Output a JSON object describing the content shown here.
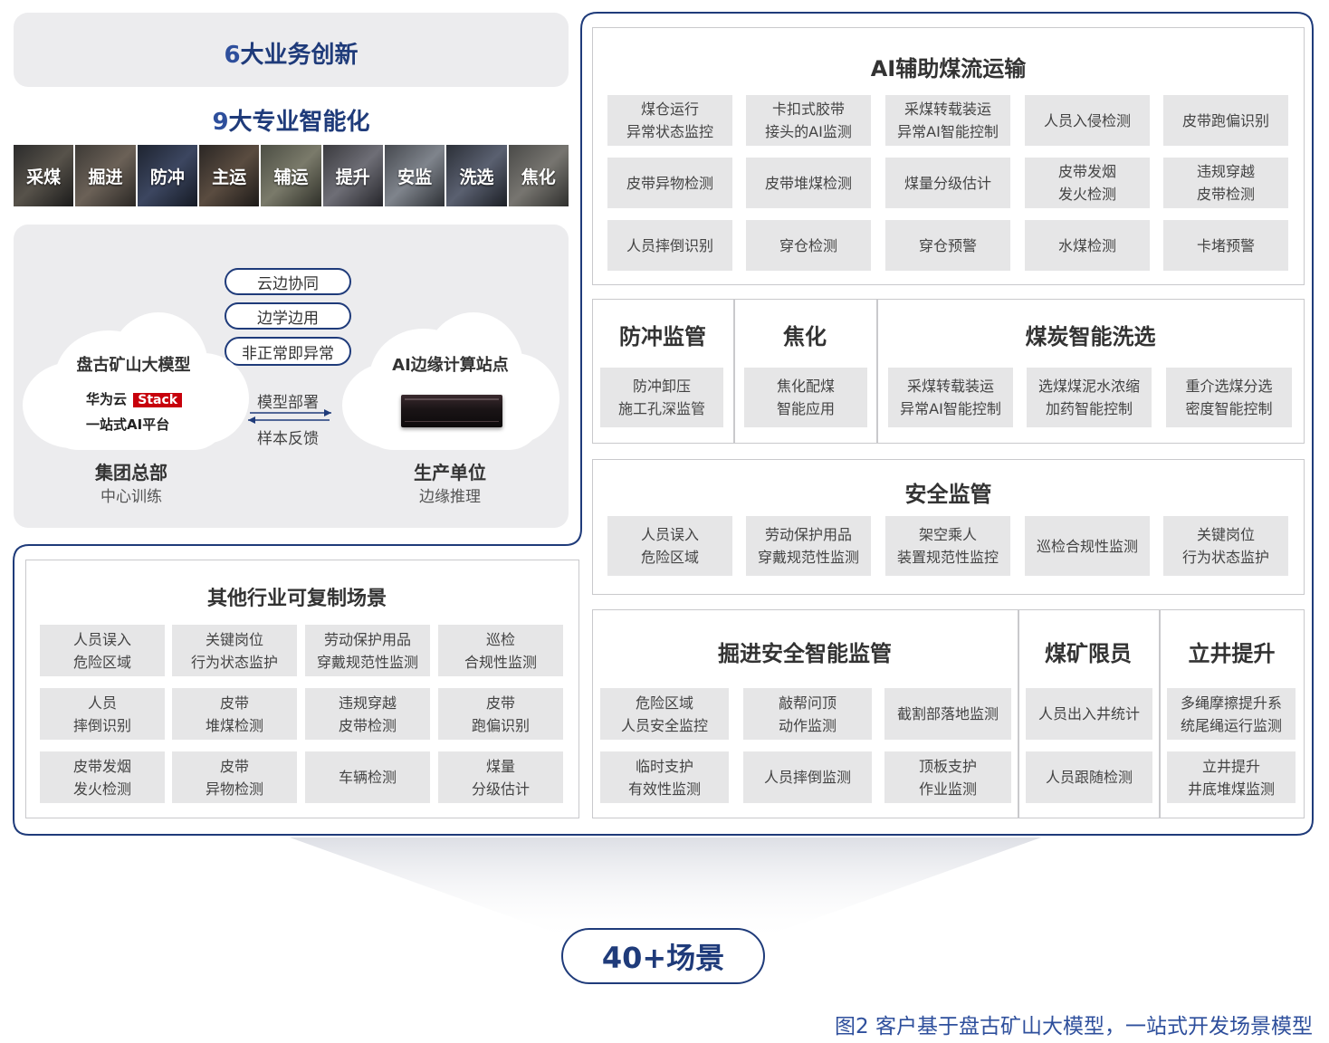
{
  "top_left": {
    "innovations_num": "6",
    "innovations_text": "大业务创新",
    "specializations_num": "9",
    "specializations_text": "大专业智能化",
    "strip": [
      "采煤",
      "掘进",
      "防冲",
      "主运",
      "辅运",
      "提升",
      "安监",
      "洗选",
      "焦化"
    ]
  },
  "architecture": {
    "pills": [
      "云边协同",
      "边学边用",
      "非正常即异常"
    ],
    "left_cloud_title": "盘古矿山大模型",
    "brand": "华为云",
    "brand_tag": "Stack",
    "platform": "一站式AI平台",
    "arrow_top": "模型部署",
    "arrow_bottom": "样本反馈",
    "right_cloud_title": "AI边缘计算站点",
    "left_label": "集团总部",
    "left_sub": "中心训练",
    "right_label": "生产单位",
    "right_sub": "边缘推理"
  },
  "other_industry": {
    "title": "其他行业可复制场景",
    "tiles": [
      "人员误入\n危险区域",
      "关键岗位\n行为状态监护",
      "劳动保护用品\n穿戴规范性监测",
      "巡检\n合规性监测",
      "人员\n摔倒识别",
      "皮带\n堆煤检测",
      "违规穿越\n皮带检测",
      "皮带\n跑偏识别",
      "皮带发烟\n发火检测",
      "皮带\n异物检测",
      "车辆检测",
      "煤量\n分级估计"
    ]
  },
  "ai_transport": {
    "title": "AI辅助煤流运输",
    "tiles": [
      "煤仓运行\n异常状态监控",
      "卡扣式胶带\n接头的AI监测",
      "采煤转载装运\n异常AI智能控制",
      "人员入侵检测",
      "皮带跑偏识别",
      "皮带异物检测",
      "皮带堆煤检测",
      "煤量分级估计",
      "皮带发烟\n发火检测",
      "违规穿越\n皮带检测",
      "人员摔倒识别",
      "穿仓检测",
      "穿仓预警",
      "水煤检测",
      "卡堵预警"
    ]
  },
  "row2": {
    "impact_title": "防冲监管",
    "impact_tile": "防冲卸压\n施工孔深监管",
    "coking_title": "焦化",
    "coking_tile": "焦化配煤\n智能应用",
    "washing_title": "煤炭智能洗选",
    "washing_tiles": [
      "采煤转载装运\n异常AI智能控制",
      "选煤煤泥水浓缩\n加药智能控制",
      "重介选煤分选\n密度智能控制"
    ]
  },
  "safety": {
    "title": "安全监管",
    "tiles": [
      "人员误入\n危险区域",
      "劳动保护用品\n穿戴规范性监测",
      "架空乘人\n装置规范性监控",
      "巡检合规性监测",
      "关键岗位\n行为状态监护"
    ]
  },
  "row4": {
    "tunnel_title": "掘进安全智能监管",
    "tunnel_tiles": [
      "危险区域\n人员安全监控",
      "敲帮问顶\n动作监测",
      "截割部落地监测",
      "临时支护\n有效性监测",
      "人员摔倒监测",
      "顶板支护\n作业监测"
    ],
    "limit_title": "煤矿限员",
    "limit_tiles": [
      "人员出入井统计",
      "人员跟随检测"
    ],
    "shaft_title": "立井提升",
    "shaft_tiles": [
      "多绳摩擦提升系\n统尾绳运行监测",
      "立井提升\n井底堆煤监测"
    ]
  },
  "summary": "40+场景",
  "caption": "图2  客户基于盘古矿山大模型，一站式开发场景模型",
  "colors": {
    "navy": "#1f3b7a",
    "tile": "#e6e6e7",
    "panel": "#ececee",
    "brand_red": "#c7000b"
  }
}
